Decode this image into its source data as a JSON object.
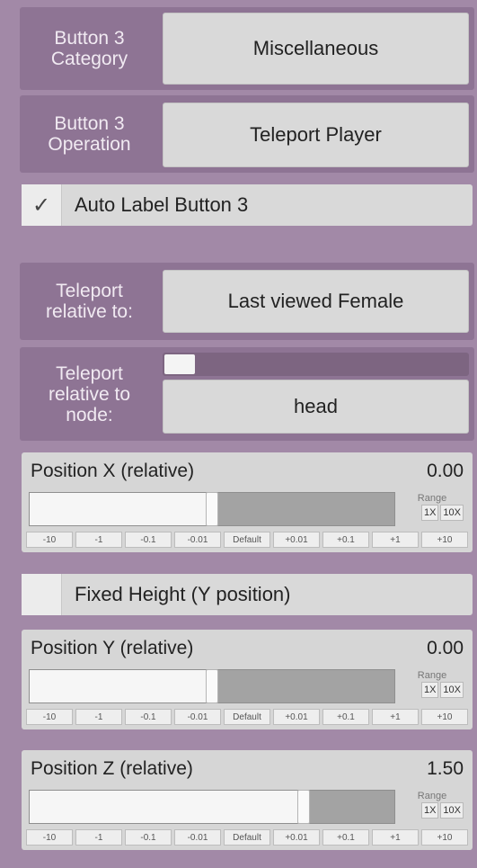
{
  "button3_category": {
    "label": "Button 3\nCategory",
    "value": "Miscellaneous"
  },
  "button3_operation": {
    "label": "Button 3\nOperation",
    "value": "Teleport Player"
  },
  "auto_label": {
    "checked_glyph": "✓",
    "label": "Auto Label Button 3",
    "checked": true
  },
  "teleport_relative": {
    "label": "Teleport\nrelative to:",
    "value": "Last viewed Female"
  },
  "teleport_node": {
    "label": "Teleport\nrelative to\nnode:",
    "value": "head",
    "slider_level": 0
  },
  "position_x": {
    "title": "Position X (relative)",
    "value_text": "0.00",
    "slider_fraction": 0.5
  },
  "fixed_height": {
    "label": "Fixed Height (Y position)",
    "checked": false
  },
  "position_y": {
    "title": "Position Y (relative)",
    "value_text": "0.00",
    "slider_fraction": 0.5
  },
  "position_z": {
    "title": "Position Z (relative)",
    "value_text": "1.50",
    "slider_fraction": 0.75
  },
  "range": {
    "label": "Range",
    "options": [
      "1X",
      "10X"
    ]
  },
  "steps": [
    "-10",
    "-1",
    "-0.1",
    "-0.01",
    "Default",
    "+0.01",
    "+0.1",
    "+1",
    "+10"
  ],
  "colors": {
    "background": "#a289a7",
    "label_panel": "#8e7494",
    "button": "#d9d9d9"
  }
}
